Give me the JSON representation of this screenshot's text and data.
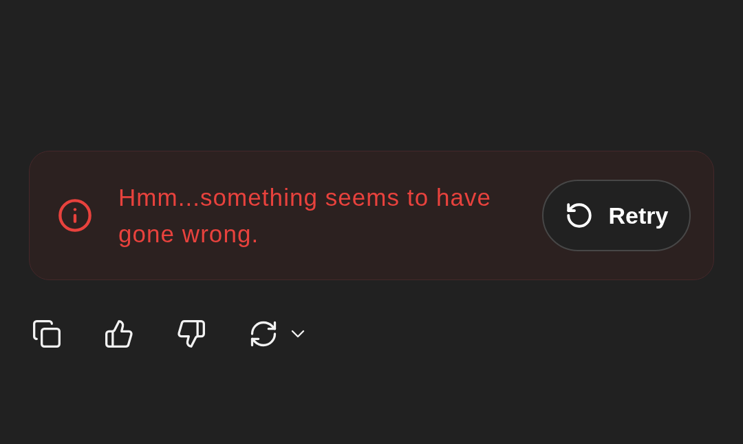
{
  "error_banner": {
    "message": "Hmm...something seems to have gone wrong.",
    "retry_button": {
      "label": "Retry"
    }
  }
}
